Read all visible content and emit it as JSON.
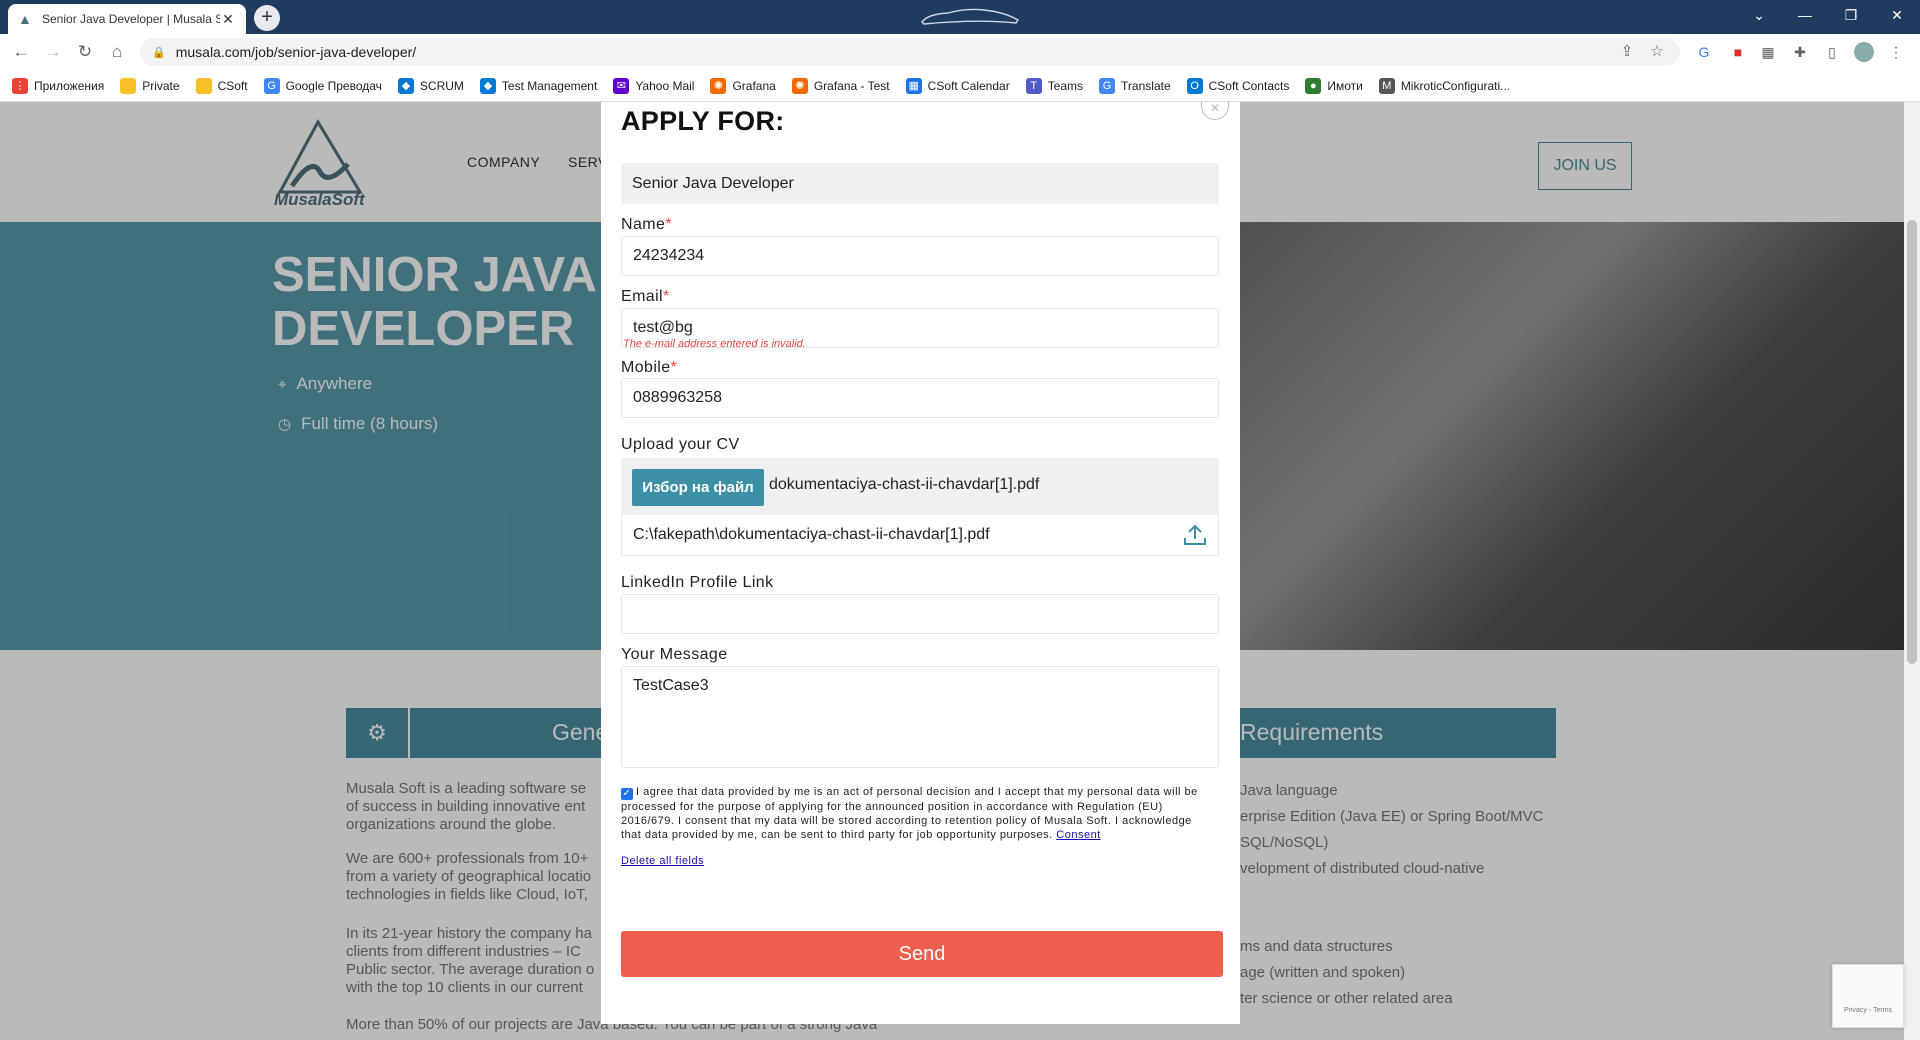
{
  "browser": {
    "tab_title": "Senior Java Developer | Musala S",
    "url": "musala.com/job/senior-java-developer/",
    "bookmarks": [
      {
        "label": "Приложения",
        "icon": "apps-grid-icon",
        "color": "#ea4335"
      },
      {
        "label": "Private",
        "icon": "folder-icon",
        "color": "#f6c026"
      },
      {
        "label": "CSoft",
        "icon": "folder-icon",
        "color": "#f6c026"
      },
      {
        "label": "Google Преводач",
        "icon": "google-translate-icon",
        "color": "#4285f4"
      },
      {
        "label": "SCRUM",
        "icon": "azure-devops-icon",
        "color": "#0078d4"
      },
      {
        "label": "Test Management",
        "icon": "azure-devops-icon",
        "color": "#0078d4"
      },
      {
        "label": "Yahoo Mail",
        "icon": "yahoo-mail-icon",
        "color": "#6001d2"
      },
      {
        "label": "Grafana",
        "icon": "grafana-icon",
        "color": "#f46800"
      },
      {
        "label": "Grafana - Test",
        "icon": "grafana-icon",
        "color": "#f46800"
      },
      {
        "label": "CSoft Calendar",
        "icon": "calendar-icon",
        "color": "#1a73e8"
      },
      {
        "label": "Teams",
        "icon": "teams-icon",
        "color": "#5059c9"
      },
      {
        "label": "Translate",
        "icon": "google-translate-icon",
        "color": "#4285f4"
      },
      {
        "label": "CSoft Contacts",
        "icon": "outlook-icon",
        "color": "#0078d4"
      },
      {
        "label": "Имоти",
        "icon": "imoti-icon",
        "color": "#2e7d32"
      },
      {
        "label": "MikroticConfigurati...",
        "icon": "mikrotik-icon",
        "color": "#555555"
      }
    ]
  },
  "site": {
    "logo_text": "MusalaSoft",
    "nav": [
      "COMPANY",
      "SERV"
    ],
    "join_label": "JOIN US",
    "hero_title": "SENIOR JAVA DEVELOPER",
    "location": "Anywhere",
    "schedule": "Full time (8 hours)",
    "section_left_title": "Gene",
    "section_right_title": "Requirements",
    "left_paragraphs": [
      "Musala Soft is a leading software se\nof success in building innovative ent\norganizations around the globe.",
      "We are 600+ professionals from 10+\nfrom a variety of geographical locatio\ntechnologies in fields like Cloud, IoT,",
      "In its 21-year history the company ha\nclients from different industries  – IC\nPublic sector. The average duration o\nwith the top 10 clients in our current",
      "More than 50% of our projects are Java based. You can be part of a strong Java"
    ],
    "right_items": [
      "Java language",
      "erprise Edition (Java EE) or Spring Boot/MVC",
      "SQL/NoSQL)",
      "velopment of distributed cloud-native",
      "ms and data structures",
      "age (written and spoken)",
      "ter science or other related area"
    ]
  },
  "modal": {
    "title": "APPLY FOR:",
    "job": "Senior Java Developer",
    "name_label": "Name",
    "name_value": "24234234",
    "email_label": "Email",
    "email_value": "test@bg",
    "email_error": "The e-mail address entered is invalid.",
    "mobile_label": "Mobile",
    "mobile_value": "0889963258",
    "cv_label": "Upload your CV",
    "file_button": "Избор на файл",
    "file_name": "dokumentaciya-chast-ii-chavdar[1].pdf",
    "file_path": "C:\\fakepath\\dokumentaciya-chast-ii-chavdar[1].pdf",
    "linkedin_label": "LinkedIn Profile Link",
    "linkedin_value": "",
    "message_label": "Your Message",
    "message_value": "TestCase3",
    "consent_text": "I agree that data provided by me is an act of personal decision and I accept that my personal data will be processed for the purpose of applying for the announced position in accordance with Regulation (EU) 2016/679. I consent that my data will be stored according to retention policy of Musala Soft. I acknowledge that data provided by me, can be sent to third party for job opportunity purposes.",
    "consent_link": "Consent",
    "delete_link": "Delete all fields",
    "send_label": "Send",
    "required_mark": "*"
  },
  "colors": {
    "accent": "#3d8fa6",
    "send": "#ee5e4d",
    "error": "#e04646",
    "hero": "#5a9aac"
  }
}
